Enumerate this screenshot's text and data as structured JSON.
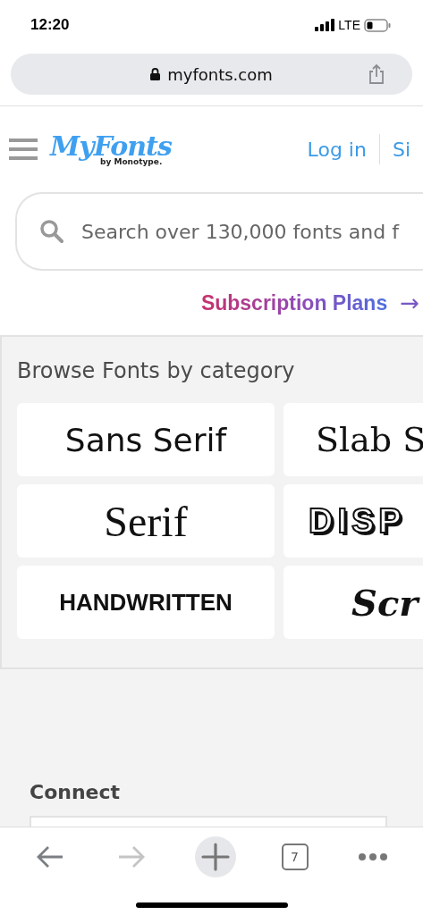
{
  "status_bar": {
    "time": "12:20",
    "network": "LTE"
  },
  "address_bar": {
    "url": "myfonts.com"
  },
  "header": {
    "logo": "MyFonts",
    "logo_tagline": "by Monotype.",
    "login": "Log in",
    "signup": "Si"
  },
  "search": {
    "placeholder": "Search over 130,000 fonts and f"
  },
  "promo_link": {
    "label": "Subscription Plans",
    "arrow": "→"
  },
  "browse": {
    "title": "Browse Fonts by category",
    "categories": [
      {
        "label": "Sans Serif",
        "kind": "sans"
      },
      {
        "label": "Slab S",
        "kind": "slab"
      },
      {
        "label": "Serif",
        "kind": "serif"
      },
      {
        "label": "DISP",
        "kind": "display"
      },
      {
        "label": "HANDWRITTEN",
        "kind": "handwritten"
      },
      {
        "label": "Scr",
        "kind": "script"
      }
    ]
  },
  "connect": {
    "title": "Connect"
  },
  "toolbar": {
    "back": {
      "disabled": false
    },
    "forward": {
      "disabled": true
    },
    "tab_count": "7"
  }
}
